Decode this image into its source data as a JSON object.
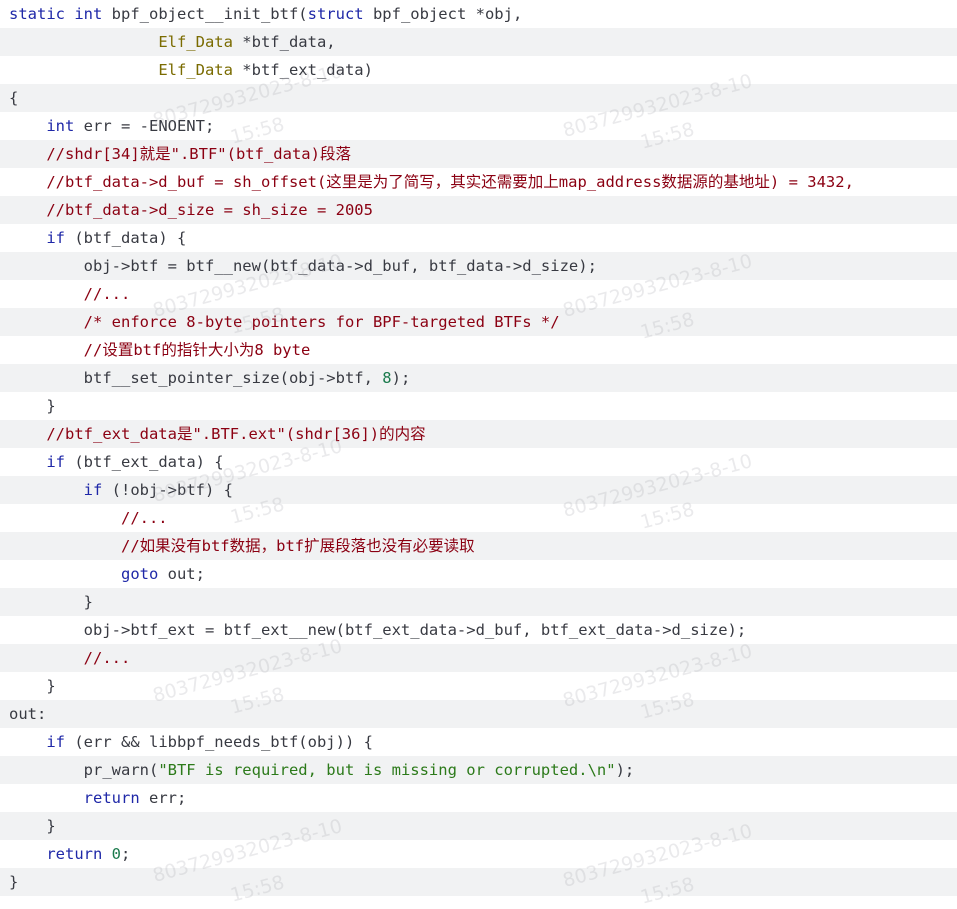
{
  "code": {
    "lines": [
      [
        {
          "t": "static ",
          "c": "kw"
        },
        {
          "t": "int",
          "c": "kw"
        },
        {
          "t": " bpf_object__init_btf(",
          "c": ""
        },
        {
          "t": "struct",
          "c": "kw"
        },
        {
          "t": " bpf_object *obj,",
          "c": ""
        }
      ],
      [
        {
          "t": "                ",
          "c": ""
        },
        {
          "t": "Elf_Data",
          "c": "ty"
        },
        {
          "t": " *btf_data,",
          "c": ""
        }
      ],
      [
        {
          "t": "                ",
          "c": ""
        },
        {
          "t": "Elf_Data",
          "c": "ty"
        },
        {
          "t": " *btf_ext_data)",
          "c": ""
        }
      ],
      [
        {
          "t": "{",
          "c": ""
        }
      ],
      [
        {
          "t": "    ",
          "c": ""
        },
        {
          "t": "int",
          "c": "kw"
        },
        {
          "t": " err = -ENOENT;",
          "c": ""
        }
      ],
      [
        {
          "t": "    //shdr[34]就是\".BTF\"(btf_data)段落",
          "c": "cm"
        }
      ],
      [
        {
          "t": "    //btf_data->d_buf = sh_offset(这里是为了简写，其实还需要加上map_address数据源的基地址) = 3432,",
          "c": "cm"
        }
      ],
      [
        {
          "t": "    //btf_data->d_size = sh_size = 2005",
          "c": "cm"
        }
      ],
      [
        {
          "t": "    ",
          "c": ""
        },
        {
          "t": "if",
          "c": "kw"
        },
        {
          "t": " (btf_data) {",
          "c": ""
        }
      ],
      [
        {
          "t": "        obj->btf = btf__new(btf_data->d_buf, btf_data->d_size);",
          "c": ""
        }
      ],
      [
        {
          "t": "        //...",
          "c": "cm"
        }
      ],
      [
        {
          "t": "        /* enforce 8-byte pointers for BPF-targeted BTFs */",
          "c": "cm"
        }
      ],
      [
        {
          "t": "        //设置btf的指针大小为8 byte",
          "c": "cm"
        }
      ],
      [
        {
          "t": "        btf__set_pointer_size(obj->btf, ",
          "c": ""
        },
        {
          "t": "8",
          "c": "nm"
        },
        {
          "t": ");",
          "c": ""
        }
      ],
      [
        {
          "t": "    }",
          "c": ""
        }
      ],
      [
        {
          "t": "    //btf_ext_data是\".BTF.ext\"(shdr[36])的内容",
          "c": "cm"
        }
      ],
      [
        {
          "t": "    ",
          "c": ""
        },
        {
          "t": "if",
          "c": "kw"
        },
        {
          "t": " (btf_ext_data) {",
          "c": ""
        }
      ],
      [
        {
          "t": "        ",
          "c": ""
        },
        {
          "t": "if",
          "c": "kw"
        },
        {
          "t": " (!obj->btf) {",
          "c": ""
        }
      ],
      [
        {
          "t": "            //...",
          "c": "cm"
        }
      ],
      [
        {
          "t": "            //如果没有btf数据，btf扩展段落也没有必要读取",
          "c": "cm"
        }
      ],
      [
        {
          "t": "            ",
          "c": ""
        },
        {
          "t": "goto",
          "c": "kw"
        },
        {
          "t": " out;",
          "c": ""
        }
      ],
      [
        {
          "t": "        }",
          "c": ""
        }
      ],
      [
        {
          "t": "        obj->btf_ext = btf_ext__new(btf_ext_data->d_buf, btf_ext_data->d_size);",
          "c": ""
        }
      ],
      [
        {
          "t": "        //...",
          "c": "cm"
        }
      ],
      [
        {
          "t": "    }",
          "c": ""
        }
      ],
      [
        {
          "t": "out:",
          "c": ""
        }
      ],
      [
        {
          "t": "    ",
          "c": ""
        },
        {
          "t": "if",
          "c": "kw"
        },
        {
          "t": " (err && libbpf_needs_btf(obj)) {",
          "c": ""
        }
      ],
      [
        {
          "t": "        pr_warn(",
          "c": ""
        },
        {
          "t": "\"BTF is required, but is missing or corrupted.\\n\"",
          "c": "st"
        },
        {
          "t": ");",
          "c": ""
        }
      ],
      [
        {
          "t": "        ",
          "c": ""
        },
        {
          "t": "return",
          "c": "kw"
        },
        {
          "t": " err;",
          "c": ""
        }
      ],
      [
        {
          "t": "    }",
          "c": ""
        }
      ],
      [
        {
          "t": "    ",
          "c": ""
        },
        {
          "t": "return",
          "c": "kw"
        },
        {
          "t": " ",
          "c": ""
        },
        {
          "t": "0",
          "c": "nm"
        },
        {
          "t": ";",
          "c": ""
        }
      ],
      [
        {
          "t": "}",
          "c": ""
        }
      ]
    ]
  },
  "watermark": {
    "id_text": "803729932023-8-10",
    "time_text": "15:58"
  }
}
